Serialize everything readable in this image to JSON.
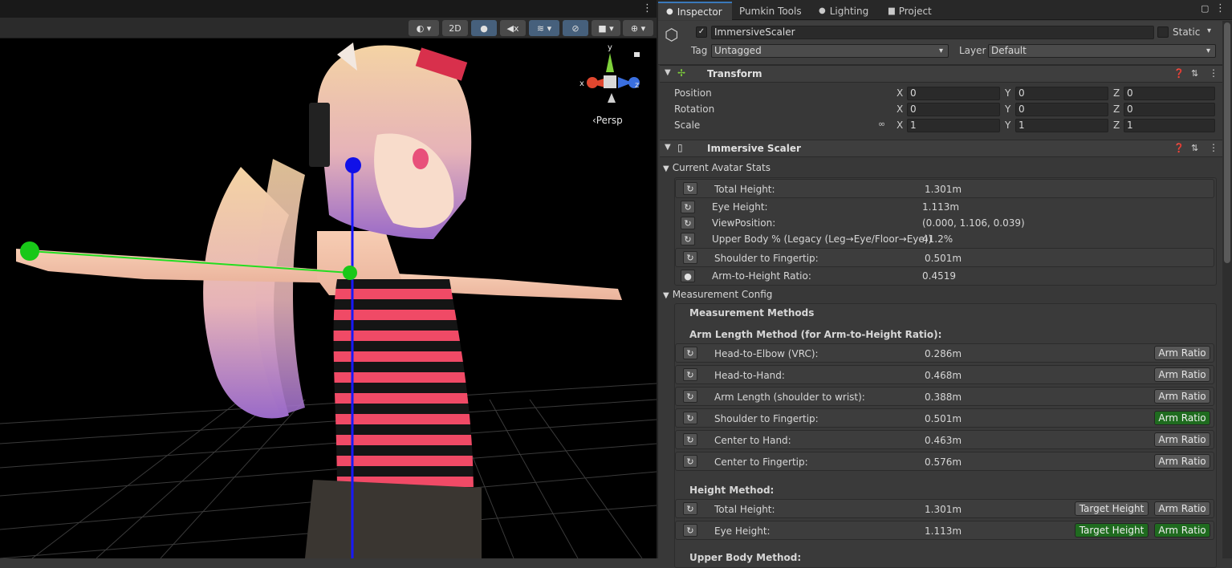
{
  "scene": {
    "toolbar": {
      "mode_2d": "2D"
    },
    "gizmo": {
      "x_label": "x",
      "y_label": "y",
      "z_label": "z",
      "persp_label": "‹Persp"
    }
  },
  "tabs": [
    {
      "label": "Inspector",
      "icon": "info-icon"
    },
    {
      "label": "Pumkin Tools",
      "icon": ""
    },
    {
      "label": "Lighting",
      "icon": "bulb-icon"
    },
    {
      "label": "Project",
      "icon": "folder-icon"
    }
  ],
  "gameobject": {
    "name": "ImmersiveScaler",
    "active": true,
    "static_label": "Static",
    "tag_label": "Tag",
    "tag_value": "Untagged",
    "layer_label": "Layer",
    "layer_value": "Default"
  },
  "transform": {
    "title": "Transform",
    "rows": [
      {
        "label": "Position",
        "x": "0",
        "y": "0",
        "z": "0"
      },
      {
        "label": "Rotation",
        "x": "0",
        "y": "0",
        "z": "0"
      },
      {
        "label": "Scale",
        "x": "1",
        "y": "1",
        "z": "1"
      }
    ],
    "axis_x": "X",
    "axis_y": "Y",
    "axis_z": "Z"
  },
  "scaler": {
    "title": "Immersive Scaler",
    "stats_title": "Current Avatar Stats",
    "stats": [
      {
        "label": "Total Height:",
        "value": "1.301m"
      },
      {
        "label": "Eye Height:",
        "value": "1.113m"
      },
      {
        "label": "ViewPosition:",
        "value": "(0.000, 1.106, 0.039)"
      },
      {
        "label": "Upper Body % (Legacy (Leg→Eye/Floor→Eye))",
        "value": "41.2%"
      },
      {
        "label": "Shoulder to Fingertip:",
        "value": "0.501m"
      },
      {
        "label": "Arm-to-Height Ratio:",
        "value": "0.4519"
      }
    ],
    "config_title": "Measurement Config",
    "methods_title": "Measurement Methods",
    "arm_title": "Arm Length Method (for Arm-to-Height Ratio):",
    "arm_methods": [
      {
        "label": "Head-to-Elbow (VRC):",
        "value": "0.286m",
        "button": "Arm Ratio",
        "selected": false
      },
      {
        "label": "Head-to-Hand:",
        "value": "0.468m",
        "button": "Arm Ratio",
        "selected": false
      },
      {
        "label": "Arm Length (shoulder to wrist):",
        "value": "0.388m",
        "button": "Arm Ratio",
        "selected": false
      },
      {
        "label": "Shoulder to Fingertip:",
        "value": "0.501m",
        "button": "Arm Ratio",
        "selected": true
      },
      {
        "label": "Center to Hand:",
        "value": "0.463m",
        "button": "Arm Ratio",
        "selected": false
      },
      {
        "label": "Center to Fingertip:",
        "value": "0.576m",
        "button": "Arm Ratio",
        "selected": false
      }
    ],
    "height_title": "Height Method:",
    "height_methods": [
      {
        "label": "Total Height:",
        "value": "1.301m",
        "target_button": "Target Height",
        "ratio_button": "Arm Ratio",
        "target_selected": false,
        "ratio_selected": false
      },
      {
        "label": "Eye Height:",
        "value": "1.113m",
        "target_button": "Target Height",
        "ratio_button": "Arm Ratio",
        "target_selected": true,
        "ratio_selected": true
      }
    ],
    "upper_body_title": "Upper Body Method:"
  },
  "colors": {
    "selected_button": "#1f6b1f",
    "accent_tab": "#3a79bb",
    "gizmo_y": "#7fd13b",
    "gizmo_x": "#e0472f",
    "gizmo_z": "#3a6fe0"
  }
}
